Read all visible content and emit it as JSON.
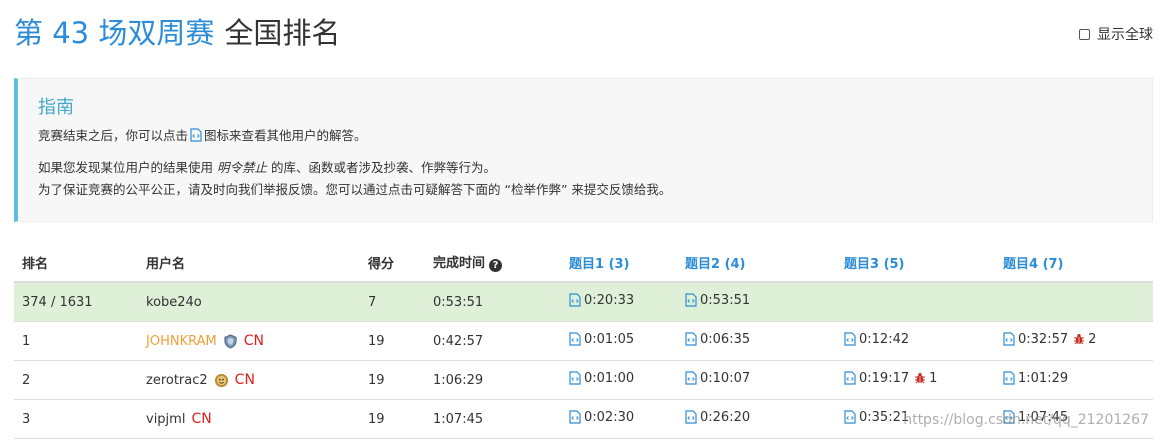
{
  "header": {
    "contest_name": "第 43 场双周赛",
    "title_suffix": "全国排名",
    "show_global_label": "显示全球"
  },
  "guide": {
    "title": "指南",
    "line1_before": "竞赛结束之后，你可以点击",
    "line1_after": "图标来查看其他用户的解答。",
    "line2_before": "如果您发现某位用户的结果使用",
    "line2_em": "明令禁止",
    "line2_after": "的库、函数或者涉及抄袭、作弊等行为。",
    "line3": "为了保证竞赛的公平公正，请及时向我们举报反馈。您可以通过点击可疑解答下面的 “检举作弊” 来提交反馈给我。"
  },
  "table": {
    "headers": {
      "rank": "排名",
      "username": "用户名",
      "score": "得分",
      "finish_time": "完成时间",
      "q1": "题目1 (3)",
      "q2": "题目2 (4)",
      "q3": "题目3 (5)",
      "q4": "题目4 (7)"
    },
    "rows": [
      {
        "rank": "374 / 1631",
        "username": "kobe24o",
        "score": "7",
        "finish_time": "0:53:51",
        "q1": "0:20:33",
        "q2": "0:53:51",
        "q3": "",
        "q4": "",
        "q4_wrong": ""
      },
      {
        "rank": "1",
        "username": "JOHNKRAM",
        "region": "CN",
        "score": "19",
        "finish_time": "0:42:57",
        "q1": "0:01:05",
        "q2": "0:06:35",
        "q3": "0:12:42",
        "q3_wrong": "",
        "q4": "0:32:57",
        "q4_wrong": "2"
      },
      {
        "rank": "2",
        "username": "zerotrac2",
        "region": "CN",
        "score": "19",
        "finish_time": "1:06:29",
        "q1": "0:01:00",
        "q2": "0:10:07",
        "q3": "0:19:17",
        "q3_wrong": "1",
        "q4": "1:01:29"
      },
      {
        "rank": "3",
        "username": "vipjml",
        "region": "CN",
        "score": "19",
        "finish_time": "1:07:45",
        "q1": "0:02:30",
        "q2": "0:26:20",
        "q3": "0:35:21",
        "q4": "1:07:45"
      }
    ]
  },
  "watermark": "https://blog.csdn.net/qq_21201267",
  "colors": {
    "accent": "#2d8cd8",
    "my_row_bg": "#dff0d8",
    "guide_border": "#5bc0de",
    "region_red": "#e0201e",
    "orange_user": "#f0a03a"
  }
}
